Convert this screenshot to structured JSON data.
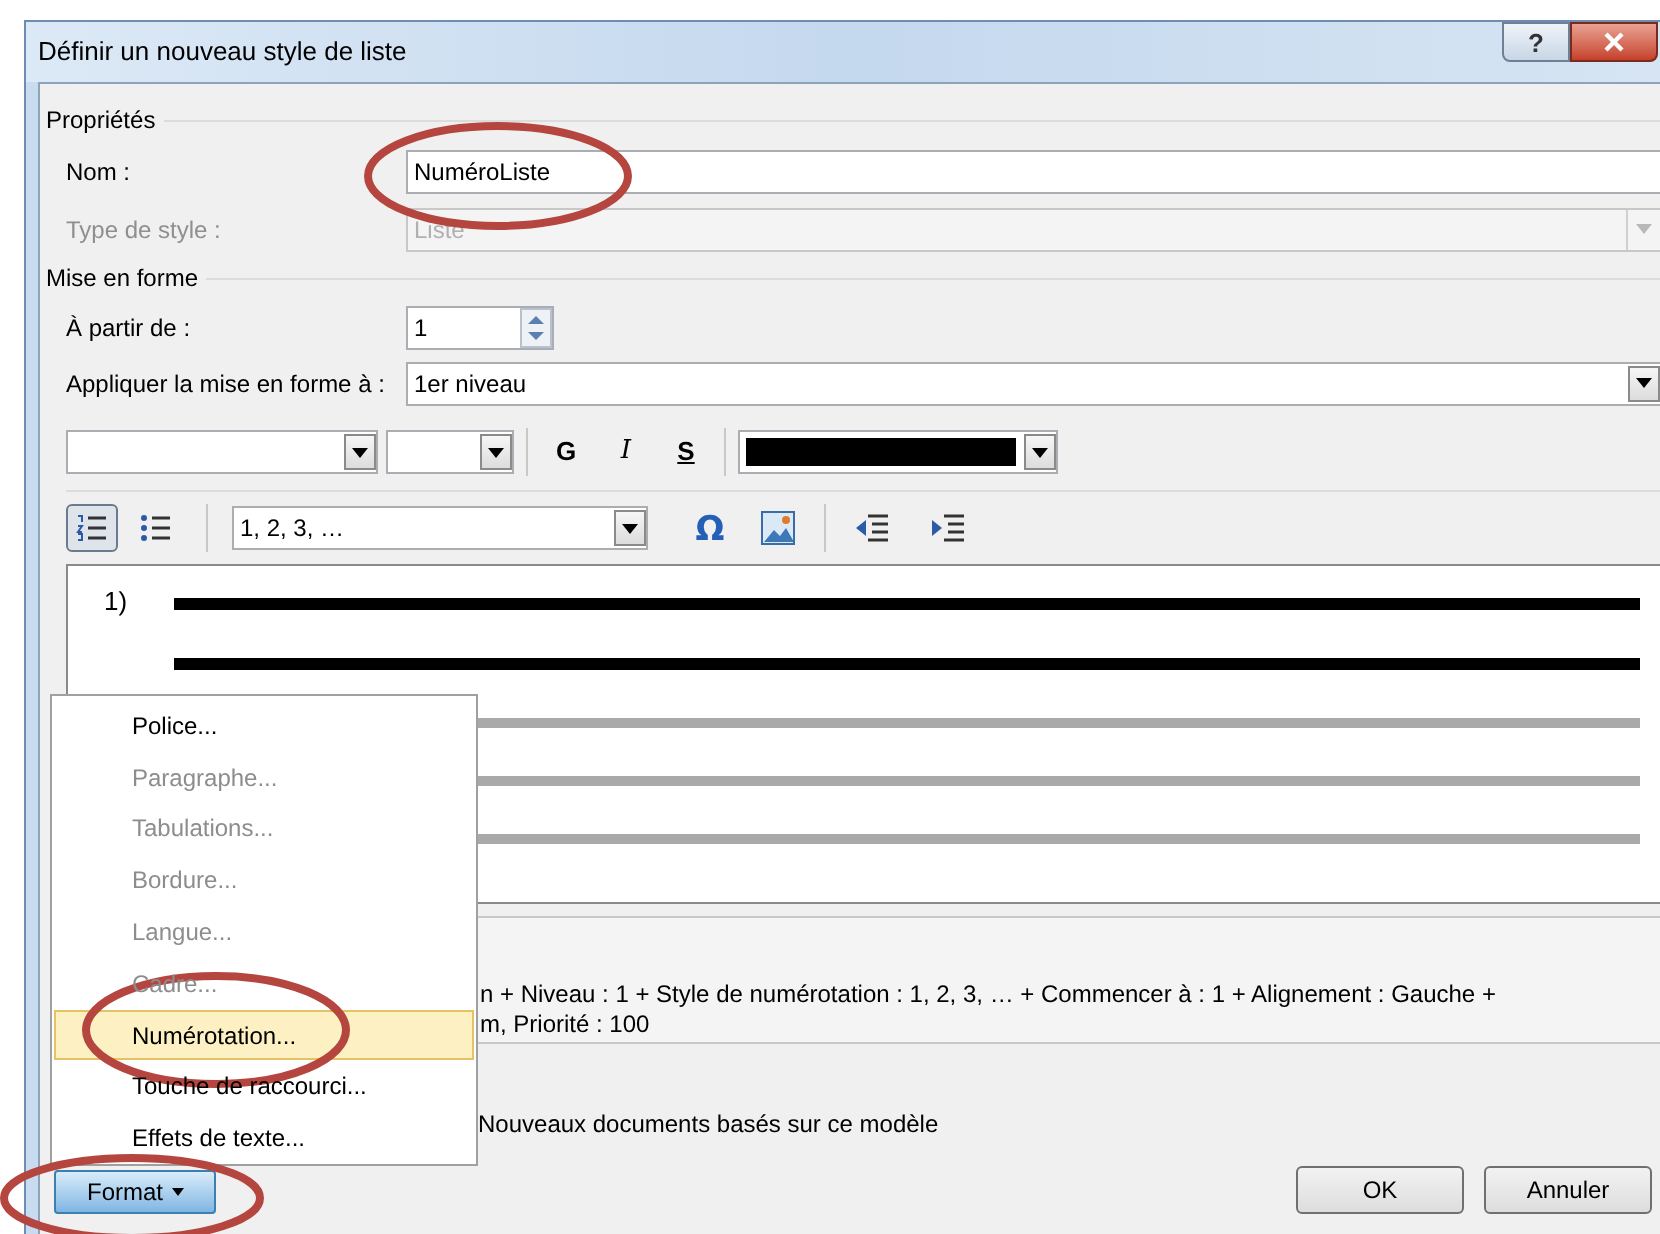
{
  "window": {
    "title": "Définir un nouveau style de liste",
    "help_label": "?"
  },
  "properties": {
    "heading": "Propriétés",
    "fields": [
      {
        "kind": "text",
        "label": "Nom :",
        "value": "NuméroListe",
        "disabled": false
      },
      {
        "kind": "dropdown",
        "label": "Type de style :",
        "value": "Liste",
        "disabled": true
      }
    ]
  },
  "formatting": {
    "heading": "Mise en forme",
    "start_label": "À partir de :",
    "start_value": "1",
    "apply_label": "Appliquer la mise en forme à :",
    "apply_value": "1er niveau",
    "font_buttons": [
      {
        "kind": "bold",
        "label": "G"
      },
      {
        "kind": "italic",
        "label": "I"
      },
      {
        "kind": "underline",
        "label": "S"
      }
    ],
    "list_buttons": [
      {
        "kind": "numbered",
        "selected": true
      },
      {
        "kind": "bulleted",
        "selected": false
      }
    ],
    "number_style": "1, 2, 3, …",
    "symbol_label": "Ω"
  },
  "preview": {
    "number": "1)",
    "lines": [
      {
        "kind": "current"
      },
      {
        "kind": "current"
      },
      {
        "kind": "following"
      },
      {
        "kind": "following"
      },
      {
        "kind": "following"
      }
    ]
  },
  "description": [
    "n + Niveau : 1 + Style de numérotation : 1, 2, 3, … + Commencer à : 1 + Alignement : Gauche +",
    "m, Priorité : 100"
  ],
  "template_option": "Nouveaux documents basés sur ce modèle",
  "buttons": [
    "OK",
    "Annuler"
  ],
  "format_button": "Format",
  "format_menu": [
    {
      "label": "Police...",
      "disabled": false,
      "selected": false
    },
    {
      "label": "Paragraphe...",
      "disabled": true,
      "selected": false
    },
    {
      "label": "Tabulations...",
      "disabled": true,
      "selected": false
    },
    {
      "label": "Bordure...",
      "disabled": true,
      "selected": false
    },
    {
      "label": "Langue...",
      "disabled": true,
      "selected": false
    },
    {
      "label": "Cadre...",
      "disabled": true,
      "selected": false
    },
    {
      "label": "Numérotation...",
      "disabled": false,
      "selected": true
    },
    {
      "label": "Touche de raccourci...",
      "disabled": false,
      "selected": false
    },
    {
      "label": "Effets de texte...",
      "disabled": false,
      "selected": false
    }
  ]
}
